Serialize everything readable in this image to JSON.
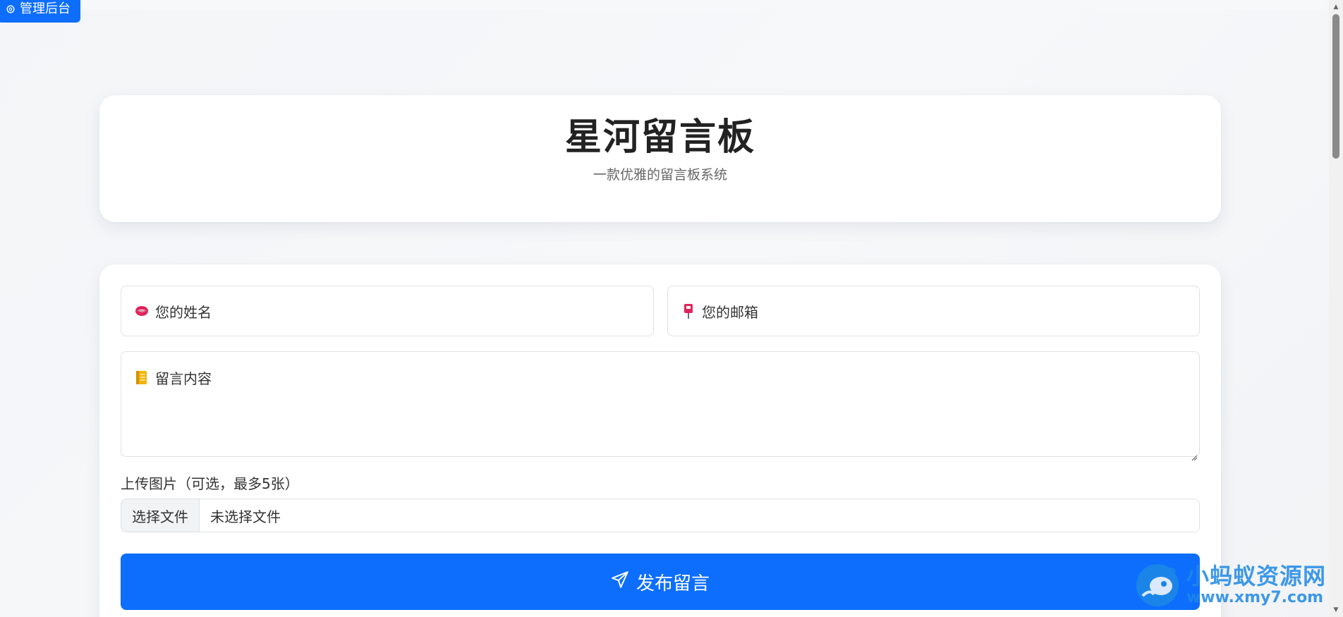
{
  "admin_button": {
    "label": "管理后台",
    "icon": "gear-icon"
  },
  "header": {
    "title": "星河留言板",
    "subtitle": "一款优雅的留言板系统"
  },
  "form": {
    "name_placeholder": "您的姓名",
    "name_icon": "lips-icon",
    "email_placeholder": "您的邮箱",
    "email_icon": "mailbox-icon",
    "content_placeholder": "留言内容",
    "content_icon": "notebook-icon",
    "upload_label": "上传图片（可选，最多5张）",
    "file_button_label": "选择文件",
    "file_status": "未选择文件",
    "submit_label": "发布留言",
    "submit_icon": "send-icon"
  },
  "watermark": {
    "title": "小蚂蚁资源网",
    "url": "www.xmy7.com"
  },
  "colors": {
    "primary": "#0d6efd",
    "watermark": "#1e88e5"
  }
}
